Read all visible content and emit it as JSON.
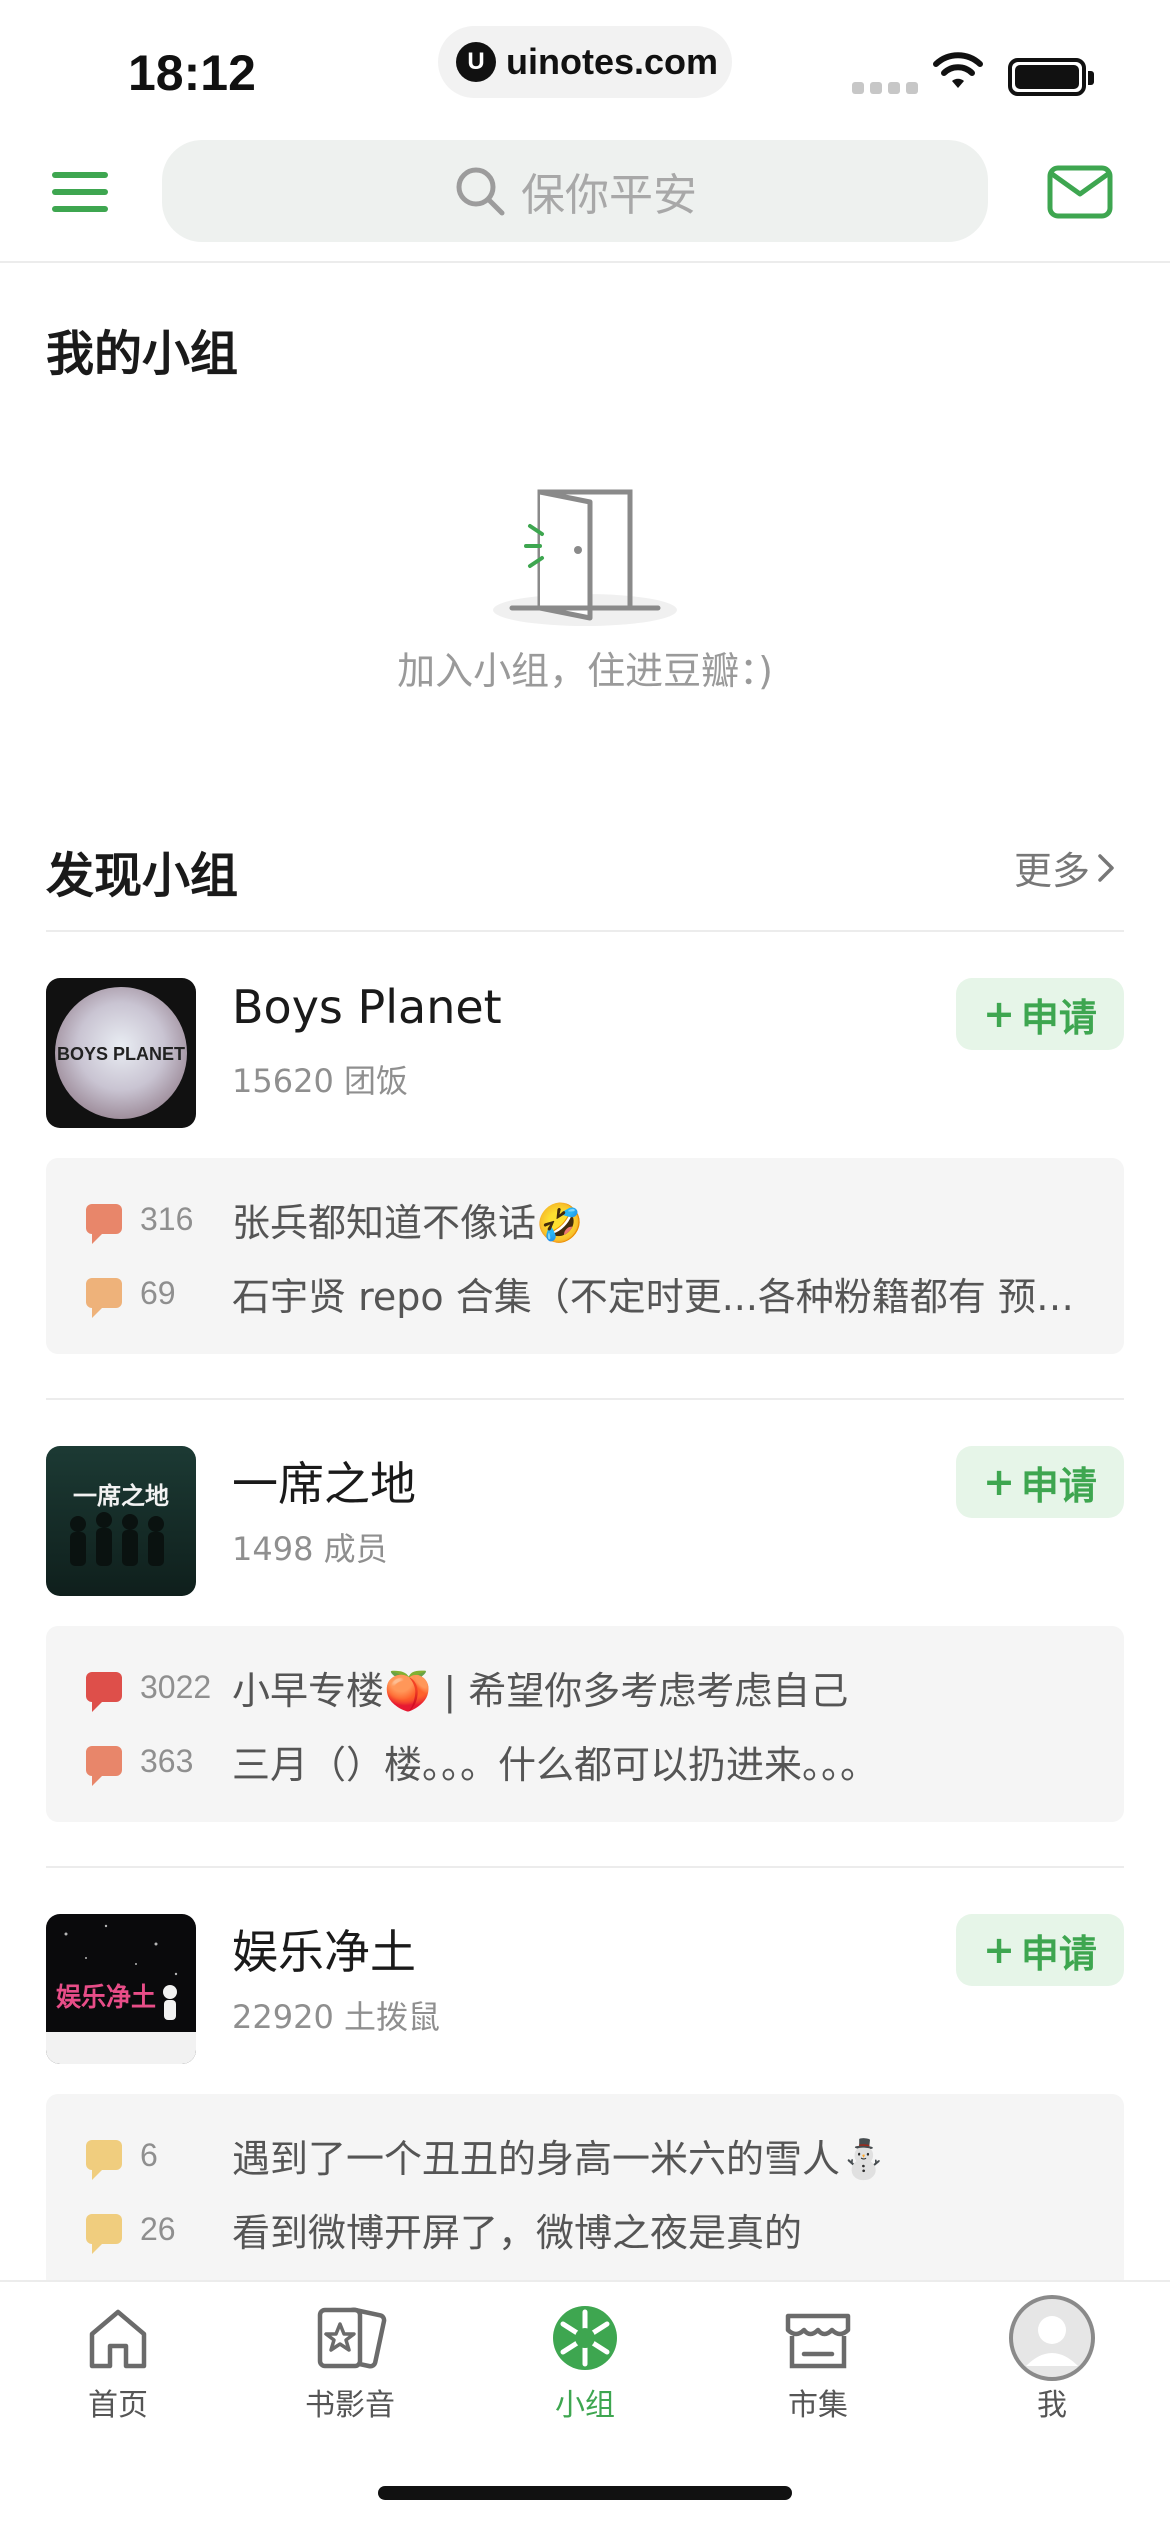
{
  "status_bar": {
    "time": "18:12",
    "url": "uinotes.com",
    "url_logo": "U"
  },
  "top_nav": {
    "search_placeholder": "保你平安"
  },
  "my_groups": {
    "title": "我的小组",
    "empty_text": "加入小组，住进豆瓣：)"
  },
  "discover": {
    "title": "发现小组",
    "more_label": "更多",
    "apply_label": "申请",
    "groups": [
      {
        "name": "Boys Planet",
        "meta": "15620 团饭",
        "avatar_text": "BOYS PLANET",
        "posts": [
          {
            "count": "316",
            "title": "张兵都知道不像话🤣",
            "bubble_color": "#e8866a"
          },
          {
            "count": "69",
            "title": "石宇贤 repo 合集（不定时更...各种粉籍都有 预…",
            "bubble_color": "#eeb27a"
          }
        ]
      },
      {
        "name": "一席之地",
        "meta": "1498 成员",
        "avatar_text": "一席之地",
        "posts": [
          {
            "count": "3022",
            "title": "小早专楼🍑 | 希望你多考虑考虑自己",
            "bubble_color": "#de4f4a"
          },
          {
            "count": "363",
            "title": "三月（）楼。。。什么都可以扔进来。。。",
            "bubble_color": "#e8866a"
          }
        ]
      },
      {
        "name": "娱乐净土",
        "meta": "22920 土拨鼠",
        "avatar_text": "娱乐净土",
        "posts": [
          {
            "count": "6",
            "title": "遇到了一个丑丑的身高一米六的雪人⛄",
            "bubble_color": "#f0cd7e"
          },
          {
            "count": "26",
            "title": "看到微博开屏了，微博之夜是真的",
            "bubble_color": "#f0cd7e"
          }
        ]
      }
    ]
  },
  "tabs": [
    {
      "label": "首页",
      "icon": "home-icon",
      "active": false
    },
    {
      "label": "书影音",
      "icon": "book-movie-icon",
      "active": false
    },
    {
      "label": "小组",
      "icon": "group-icon",
      "active": true
    },
    {
      "label": "市集",
      "icon": "market-icon",
      "active": false
    },
    {
      "label": "我",
      "icon": "profile-avatar-icon",
      "active": false
    }
  ],
  "colors": {
    "accent": "#3ea650",
    "apply_bg": "#e6f5e8"
  }
}
